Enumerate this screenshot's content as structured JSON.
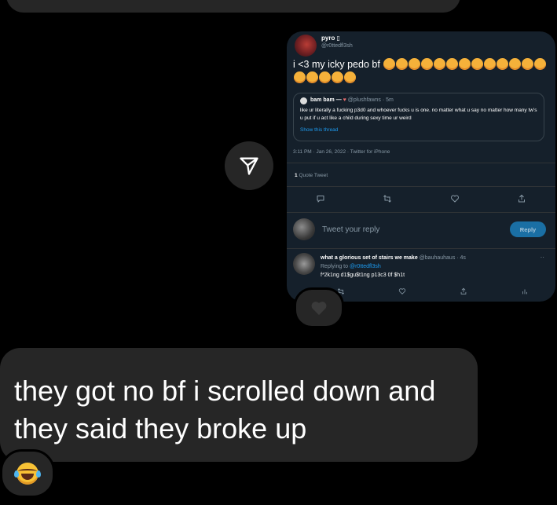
{
  "tweet": {
    "author_name": "pyro ▯",
    "author_handle": "@r0ttedfl3sh",
    "text": "i <3 my icky pedo bf",
    "emoji_count": 18,
    "quoted": {
      "name": "bam bam",
      "separator": "—",
      "handle_time": "@plushfawns · 5m",
      "text": "like ur literally a fucking p3d0 and whoever fucks u is one. no matter what u say no matter how many tw's u put if u act like a child during sexy time ur weird",
      "show_thread": "Show this thread"
    },
    "timestamp": "3:11 PM · Jan 26, 2022 · Twitter for iPhone",
    "quote_count_number": "1",
    "quote_count_label": "Quote Tweet",
    "reply_placeholder": "Tweet your reply",
    "reply_button": "Reply",
    "comment": {
      "name": "what a glorious set of stairs we make",
      "handle_time": "@bauhauhaus · 4s",
      "replying_prefix": "Replying to",
      "replying_handle": "@r0ttedfl3sh",
      "text": "f*2k1ng d1$gu$t1ng p13c3 0f $h1t",
      "more": "··"
    }
  },
  "message": {
    "text": "they got no bf i scrolled down and they said they broke up"
  },
  "colors": {
    "bubble": "#262626",
    "tweet_bg": "#15202b",
    "link": "#1d9bf0",
    "muted": "#8899a6"
  },
  "icons": {
    "share": "paper-plane-icon",
    "heart_reaction": "black-heart-icon",
    "laugh_reaction": "tears-of-joy-icon"
  }
}
